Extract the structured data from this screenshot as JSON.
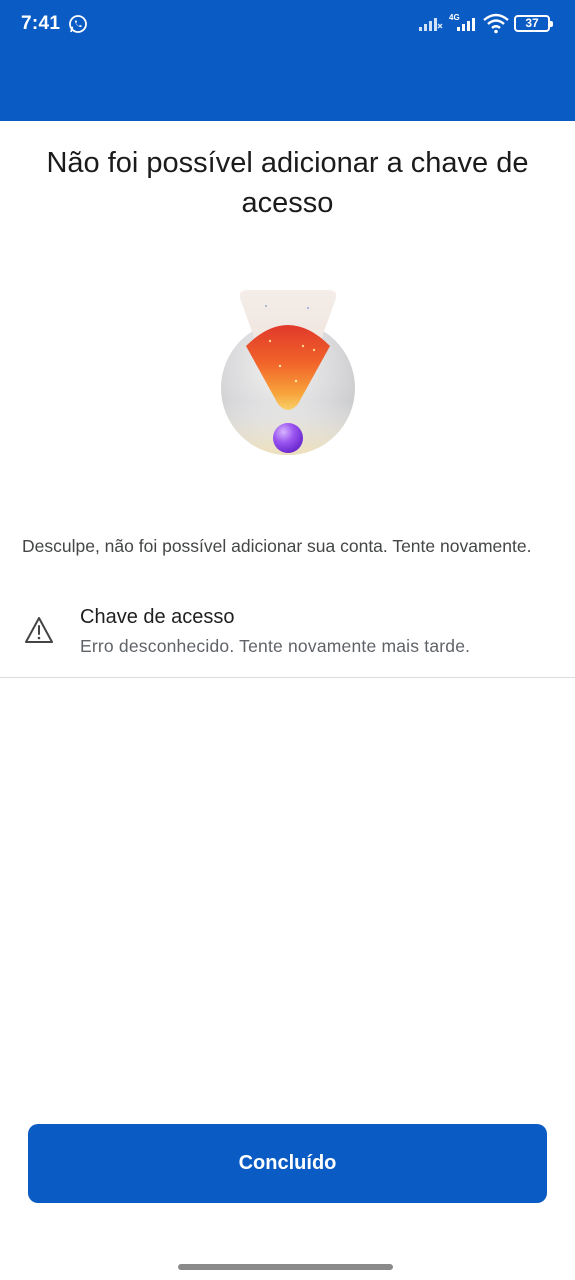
{
  "status_bar": {
    "time": "7:41",
    "network": "4G",
    "battery": "37"
  },
  "page": {
    "title": "Não foi possível adicionar a chave de acesso",
    "description": "Desculpe, não foi possível adicionar sua conta. Tente novamente.",
    "item": {
      "icon": "warning-icon",
      "title": "Chave de acesso",
      "subtitle": "Erro desconhecido. Tente novamente mais tarde."
    },
    "done_button": "Concluído"
  },
  "colors": {
    "accent": "#0a5bc4",
    "background": "#ffffff"
  }
}
